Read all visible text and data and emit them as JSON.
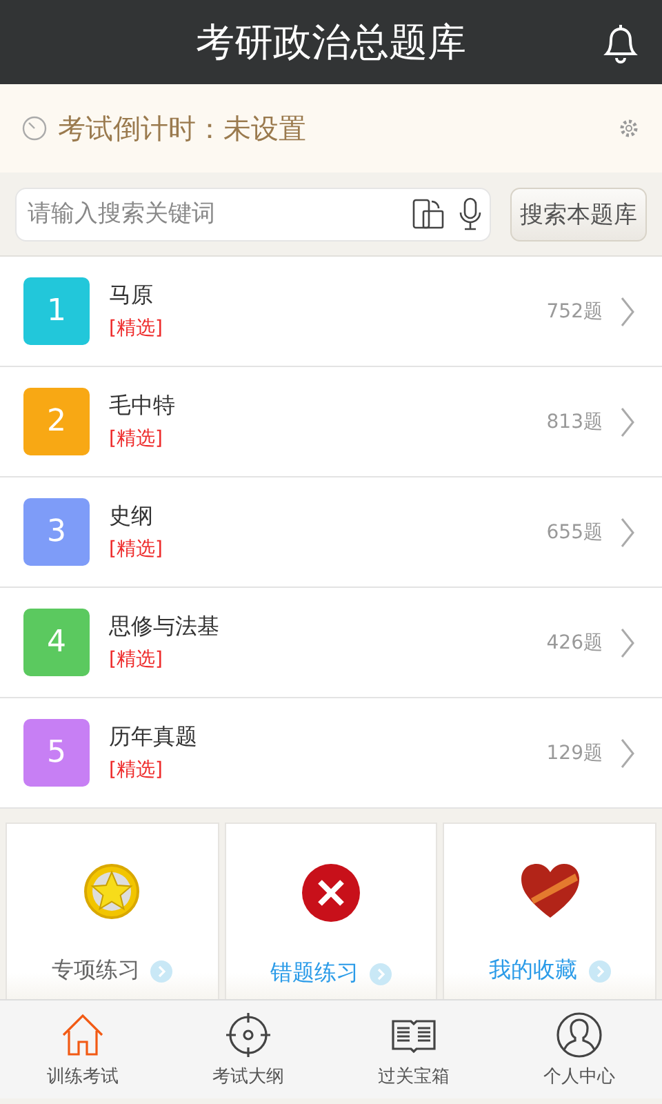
{
  "header": {
    "title": "考研政治总题库"
  },
  "countdown": {
    "text": "考试倒计时：未设置"
  },
  "search": {
    "placeholder": "请输入搜索关键词",
    "button": "搜索本题库"
  },
  "subjects": [
    {
      "number": "1",
      "name": "马原",
      "tag": "[精选]",
      "count": "752题",
      "color": "#22c7da"
    },
    {
      "number": "2",
      "name": "毛中特",
      "tag": "[精选]",
      "count": "813题",
      "color": "#f8a814"
    },
    {
      "number": "3",
      "name": "史纲",
      "tag": "[精选]",
      "count": "655题",
      "color": "#7e9cf8"
    },
    {
      "number": "4",
      "name": "思修与法基",
      "tag": "[精选]",
      "count": "426题",
      "color": "#5bc95f"
    },
    {
      "number": "5",
      "name": "历年真题",
      "tag": "[精选]",
      "count": "129题",
      "color": "#c77ff4"
    }
  ],
  "cards": [
    {
      "kind": "star",
      "label": "专项练习",
      "color": "#666666"
    },
    {
      "kind": "cross",
      "label": "错题练习",
      "color": "#2a9be8"
    },
    {
      "kind": "heart",
      "label": "我的收藏",
      "color": "#2a9be8"
    }
  ],
  "tabs": [
    {
      "kind": "home",
      "label": "训练考试",
      "selected": true
    },
    {
      "kind": "target",
      "label": "考试大纲",
      "selected": false
    },
    {
      "kind": "book",
      "label": "过关宝箱",
      "selected": false
    },
    {
      "kind": "person",
      "label": "个人中心",
      "selected": false
    }
  ]
}
